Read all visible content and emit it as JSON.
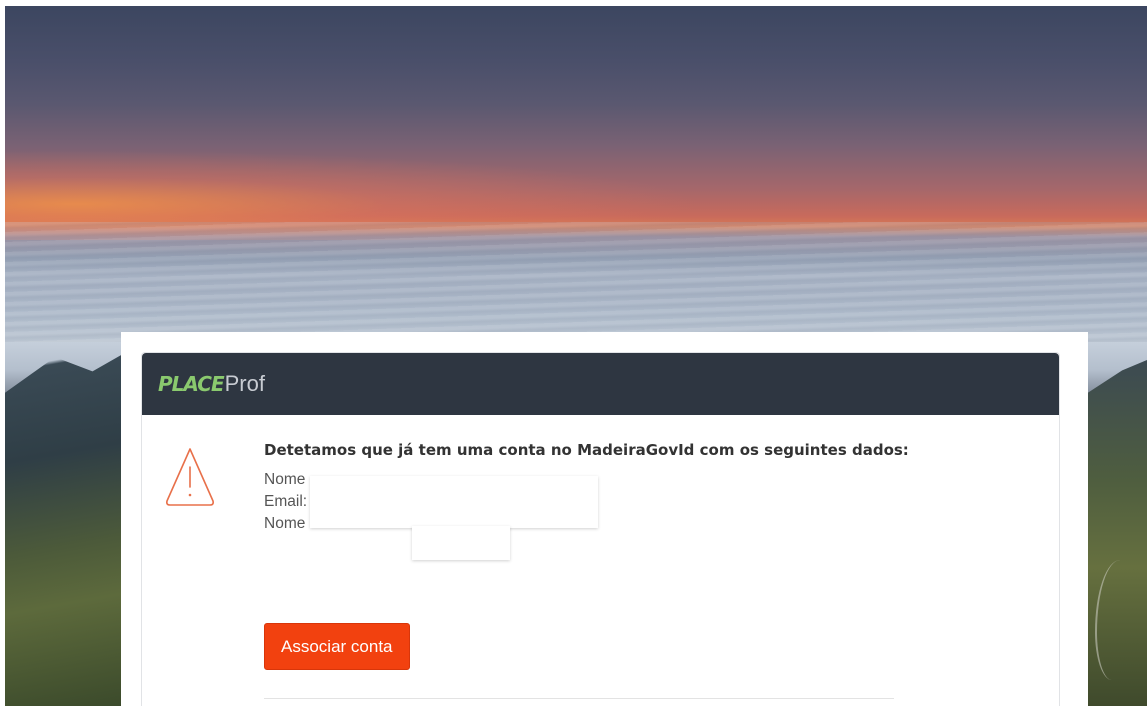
{
  "brand": {
    "logo_place": "PLACE",
    "logo_prof": "Prof"
  },
  "notice": {
    "icon": "warning-triangle-icon",
    "heading": "Detetamos que já tem uma conta no MadeiraGovId com os seguintes dados:",
    "fields": [
      {
        "label": "Nome",
        "value": ""
      },
      {
        "label": "Email:",
        "value": ""
      },
      {
        "label": "Nome de utilizador",
        "value": ""
      }
    ]
  },
  "actions": {
    "associate_label": "Associar conta"
  },
  "colors": {
    "header_bg": "#2e3641",
    "logo_green": "#8ac96e",
    "button_bg": "#f2410f",
    "warning_orange": "#e8704a"
  }
}
